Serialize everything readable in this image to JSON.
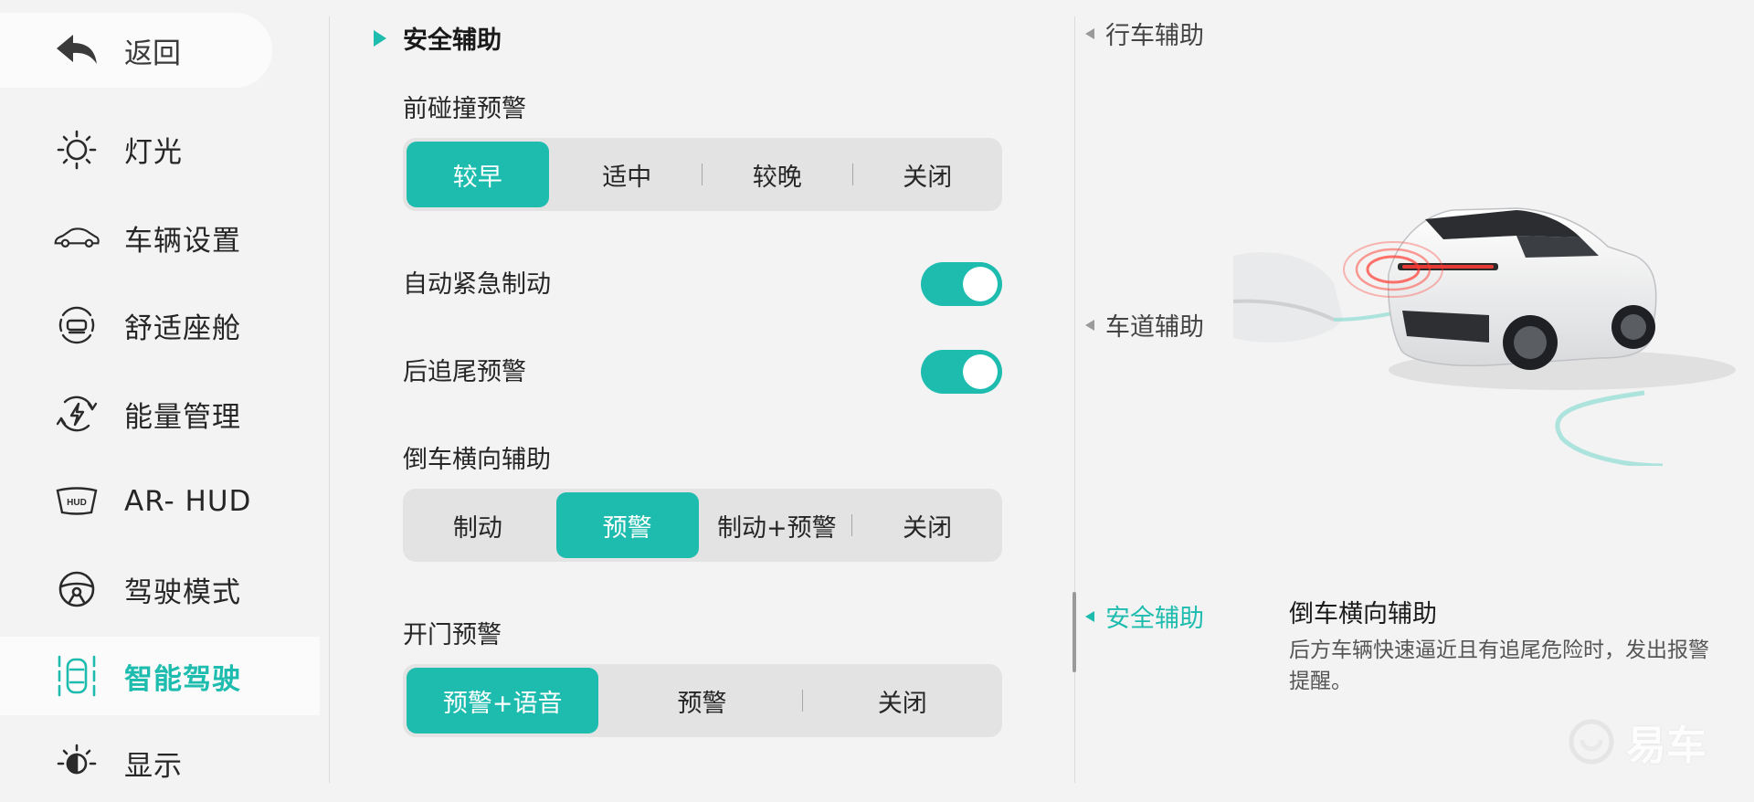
{
  "sidebar": {
    "back_label": "返回",
    "items": [
      {
        "label": "灯光",
        "icon": "light-bulb-icon"
      },
      {
        "label": "车辆设置",
        "icon": "car-outline-icon"
      },
      {
        "label": "舒适座舱",
        "icon": "cabin-icon"
      },
      {
        "label": "能量管理",
        "icon": "energy-icon"
      },
      {
        "label": "AR- HUD",
        "icon": "hud-icon"
      },
      {
        "label": "驾驶模式",
        "icon": "steering-wheel-icon"
      },
      {
        "label": "智能驾驶",
        "icon": "smart-driving-icon",
        "active": true
      },
      {
        "label": "显示",
        "icon": "display-icon"
      }
    ]
  },
  "main": {
    "section_title": "安全辅助",
    "forward_collision": {
      "label": "前碰撞预警",
      "options": [
        "较早",
        "适中",
        "较晚",
        "关闭"
      ],
      "selected": "较早"
    },
    "aeb": {
      "label": "自动紧急制动",
      "on": true
    },
    "rear_collision": {
      "label": "后追尾预警",
      "on": true
    },
    "reverse_cross": {
      "label": "倒车横向辅助",
      "options": [
        "制动",
        "预警",
        "制动+预警",
        "关闭"
      ],
      "selected": "预警"
    },
    "door_open": {
      "label": "开门预警",
      "options": [
        "预警+语音",
        "预警",
        "关闭"
      ],
      "selected": "预警+语音"
    }
  },
  "right_panel": {
    "categories": [
      "行车辅助",
      "车道辅助",
      "安全辅助"
    ],
    "active_category": "安全辅助",
    "description_title": "倒车横向辅助",
    "description_body": "后方车辆快速逼近且有追尾危险时，发出报警提醒。"
  },
  "watermark": "易车",
  "colors": {
    "accent": "#1ebcae",
    "background": "#f3f3f3",
    "segment_bg": "#e3e3e3"
  }
}
